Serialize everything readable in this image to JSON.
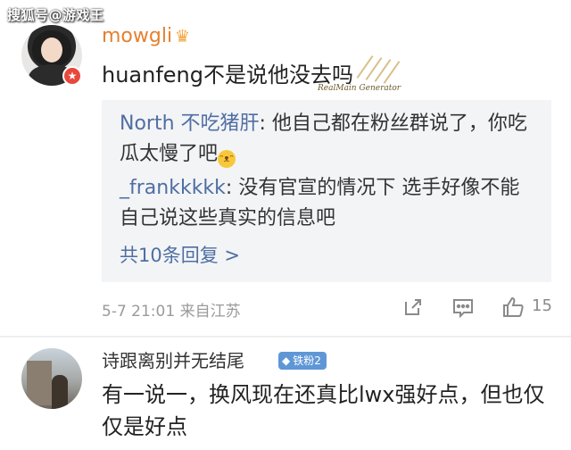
{
  "watermark": "搜狐号@游戏王",
  "comment1": {
    "username": "mowgli",
    "text": "huanfeng不是说他没去吗",
    "deco_tag": "RealMain Generator",
    "replies": [
      {
        "name": "North 不吃猪肝",
        "text": ": 他自己都在粉丝群说了，你吃瓜太慢了吧"
      },
      {
        "name": "_frankkkkk",
        "text": ": 没有官宣的情况下 选手好像不能自己说这些真实的信息吧"
      }
    ],
    "more_replies": "共10条回复 >",
    "meta": "5-7 21:01 来自江苏",
    "like_count": "15"
  },
  "comment2": {
    "username": "诗跟离别并无结尾",
    "badge": "铁粉2",
    "text": "有一说一，换风现在还真比lwx强好点，但也仅仅是好点"
  },
  "icons": {
    "crown": "crown-icon",
    "vip": "vip-badge-icon",
    "laugh": "laughing-emoji-icon",
    "share": "share-icon",
    "comment": "comment-icon",
    "like": "thumbs-up-icon",
    "fan": "diamond-icon"
  },
  "colors": {
    "username_orange": "#e4812f",
    "link_blue": "#4f6ea3",
    "badge_blue": "#5f97d6"
  }
}
